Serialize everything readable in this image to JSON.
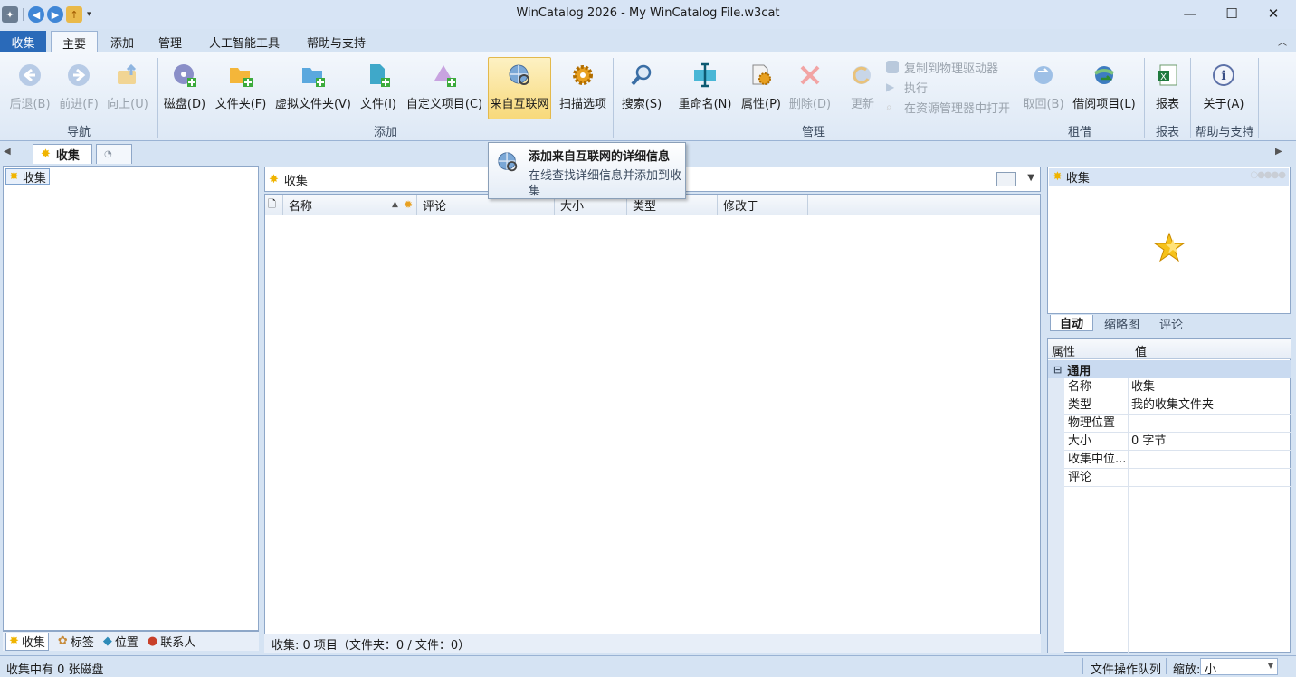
{
  "window": {
    "title": "WinCatalog 2026 - My WinCatalog File.w3cat"
  },
  "ribbon_tabs": [
    {
      "label": "收集"
    },
    {
      "label": "主要"
    },
    {
      "label": "添加"
    },
    {
      "label": "管理"
    },
    {
      "label": "人工智能工具"
    },
    {
      "label": "帮助与支持"
    }
  ],
  "ribbon": {
    "nav": {
      "label": "导航",
      "back": "后退(B)",
      "forward": "前进(F)",
      "up": "向上(U)"
    },
    "add": {
      "label": "添加",
      "disk": "磁盘(D)",
      "folder": "文件夹(F)",
      "virtual_folder": "虚拟文件夹(V)",
      "file": "文件(I)",
      "custom_item": "自定义项目(C)",
      "from_internet": "来自互联网",
      "scan_options": "扫描选项"
    },
    "manage": {
      "label": "管理",
      "search": "搜索(S)",
      "rename": "重命名(N)",
      "properties": "属性(P)",
      "delete": "删除(D)",
      "update": "更新",
      "copy_to_drive": "复制到物理驱动器",
      "execute": "执行",
      "open_in_explorer": "在资源管理器中打开"
    },
    "lending": {
      "label": "租借",
      "return": "取回(B)",
      "lend_item": "借阅项目(L)"
    },
    "reports": {
      "label": "报表",
      "report": "报表"
    },
    "help": {
      "label": "帮助与支持",
      "about": "关于(A)"
    }
  },
  "tooltip": {
    "title": "添加来自互联网的详细信息",
    "line1": "在线查找详细信息并添加到收",
    "line2": "集"
  },
  "doc_tab": {
    "label": "收集"
  },
  "tree": {
    "root": "收集"
  },
  "left_bottom_tabs": [
    {
      "label": "收集"
    },
    {
      "label": "标签"
    },
    {
      "label": "位置"
    },
    {
      "label": "联系人"
    }
  ],
  "path": {
    "current": "收集"
  },
  "columns": [
    {
      "label": "名称"
    },
    {
      "label": "评论"
    },
    {
      "label": "大小"
    },
    {
      "label": "类型"
    },
    {
      "label": "修改于"
    }
  ],
  "mid_status": "收集: 0 项目（文件夹：0 / 文件：0）",
  "preview": {
    "title": "收集",
    "tabs": [
      {
        "label": "自动"
      },
      {
        "label": "缩略图"
      },
      {
        "label": "评论"
      }
    ]
  },
  "properties": {
    "col_prop": "属性",
    "col_value": "值",
    "category": "通用",
    "rows": [
      {
        "key": "名称",
        "value": "收集"
      },
      {
        "key": "类型",
        "value": "我的收集文件夹"
      },
      {
        "key": "物理位置",
        "value": ""
      },
      {
        "key": "大小",
        "value": "0 字节"
      },
      {
        "key": "收集中位...",
        "value": ""
      },
      {
        "key": "评论",
        "value": ""
      }
    ]
  },
  "statusbar": {
    "left": "收集中有 0 张磁盘",
    "queue": "文件操作队列",
    "zoom_label": "缩放:",
    "zoom_value": "小"
  },
  "colors": {
    "accent": "#2a6ab9",
    "frame": "#d5e3f3",
    "highlight": "#f8d97a"
  }
}
